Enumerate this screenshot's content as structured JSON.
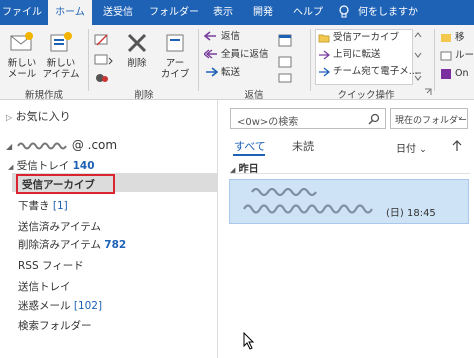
{
  "tabs": [
    "ファイル",
    "ホーム",
    "送受信",
    "フォルダー",
    "表示",
    "開発",
    "ヘルプ"
  ],
  "active_tab": "ホーム",
  "tell_me": "何をしますか",
  "ribbon": {
    "new_mail": [
      "新しい",
      "メール"
    ],
    "new_items": [
      "新しい",
      "アイテム"
    ],
    "delete": "削除",
    "archive": [
      "アー",
      "カイブ"
    ],
    "reply": "返信",
    "reply_all": "全員に返信",
    "forward": "転送",
    "quick_steps": [
      "受信アーカイブ",
      "上司に転送",
      "チーム宛て電子メ..."
    ],
    "groups": {
      "new": "新規作成",
      "delete": "削除",
      "respond": "返信",
      "quick_steps": "クイック操作"
    },
    "cut_right": [
      "移",
      "ルー",
      "On"
    ]
  },
  "folders": {
    "favorites": "お気に入り",
    "account": "@       .com",
    "items": [
      {
        "label": "受信トレイ",
        "count": "140"
      },
      {
        "label": "受信アーカイブ"
      },
      {
        "label": "下書き",
        "count": "[1]"
      },
      {
        "label": "送信済みアイテム"
      },
      {
        "label": "削除済みアイテム",
        "count": "782"
      },
      {
        "label": "RSS フィード"
      },
      {
        "label": "送信トレイ"
      },
      {
        "label": "迷惑メール",
        "count": "[102]"
      },
      {
        "label": "検索フォルダー"
      }
    ]
  },
  "mail_list": {
    "search_placeholder": "<0w>の検索",
    "scope": "現在のフォルダー",
    "filter_all": "すべて",
    "filter_unread": "未読",
    "sort": "日付",
    "group_header": "昨日",
    "message_time": "(日) 18:45"
  },
  "colors": {
    "accent": "#1e62b6",
    "highlight": "#d9262e",
    "selected": "#cfe3f6"
  }
}
